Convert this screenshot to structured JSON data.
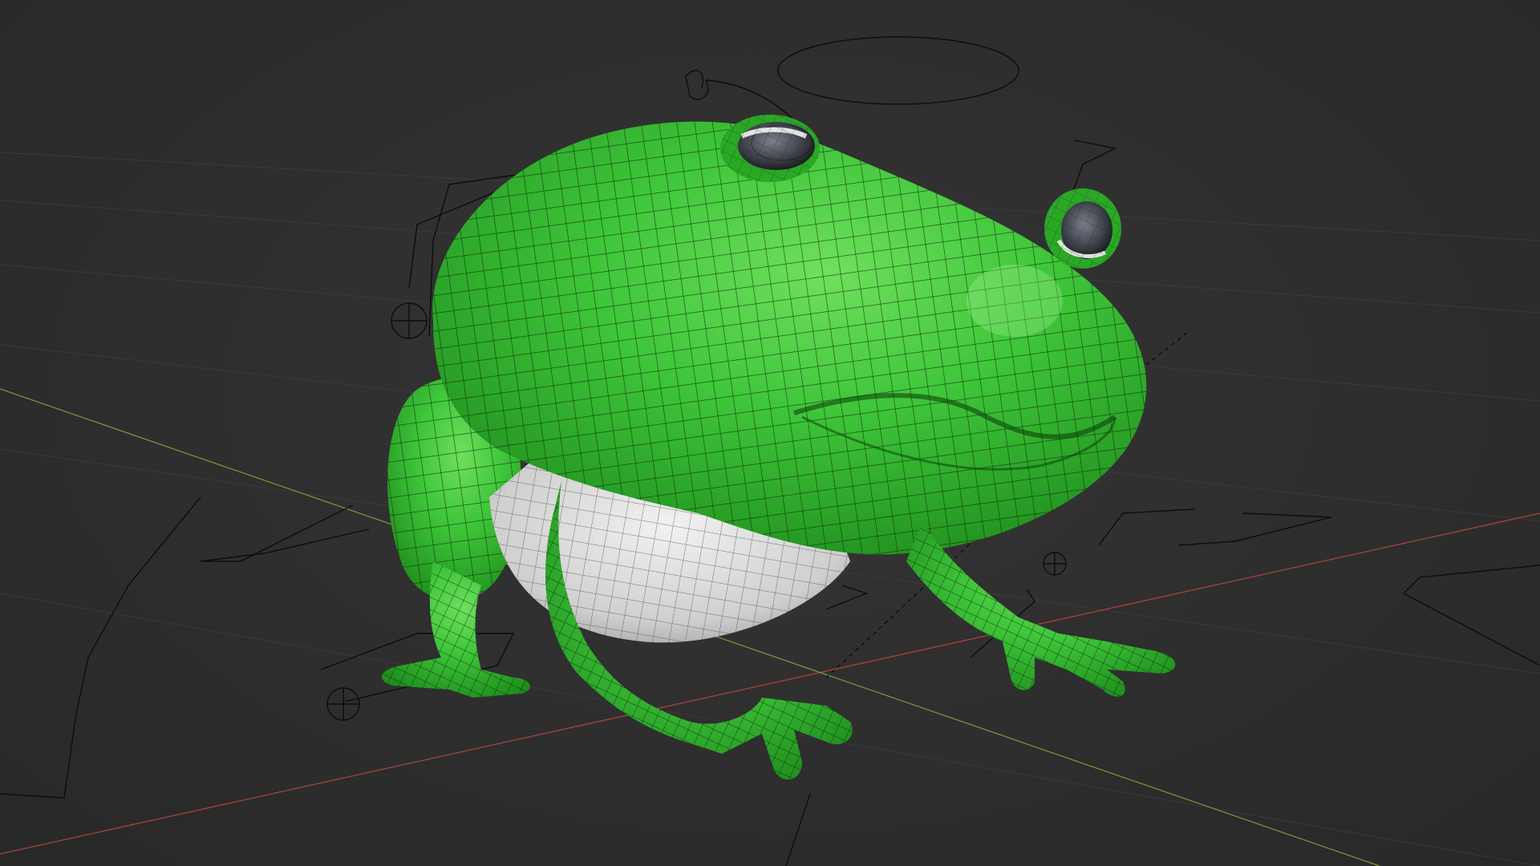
{
  "viewport": {
    "background_color": "#2e2e2e",
    "grid_color": "#3b3b3b",
    "x_axis_color": "#a0413f",
    "y_axis_color": "#7f9a3a",
    "rig_line_color": "#0e0e0e",
    "model": {
      "skin_color": "#3fc63a",
      "belly_color": "#dcdcdc",
      "eye_color": "#5a5f6c",
      "wire_color": "#0f2a0c",
      "icon": "frog-model-icon"
    }
  }
}
